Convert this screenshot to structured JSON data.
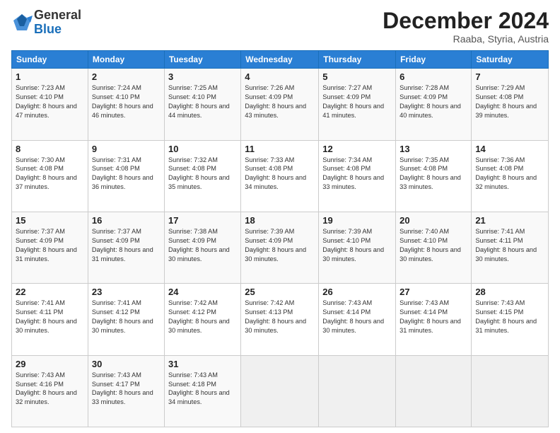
{
  "logo": {
    "general": "General",
    "blue": "Blue"
  },
  "title": "December 2024",
  "location": "Raaba, Styria, Austria",
  "days_of_week": [
    "Sunday",
    "Monday",
    "Tuesday",
    "Wednesday",
    "Thursday",
    "Friday",
    "Saturday"
  ],
  "weeks": [
    [
      {
        "day": "1",
        "sunrise": "7:23 AM",
        "sunset": "4:10 PM",
        "daylight": "8 hours and 47 minutes."
      },
      {
        "day": "2",
        "sunrise": "7:24 AM",
        "sunset": "4:10 PM",
        "daylight": "8 hours and 46 minutes."
      },
      {
        "day": "3",
        "sunrise": "7:25 AM",
        "sunset": "4:10 PM",
        "daylight": "8 hours and 44 minutes."
      },
      {
        "day": "4",
        "sunrise": "7:26 AM",
        "sunset": "4:09 PM",
        "daylight": "8 hours and 43 minutes."
      },
      {
        "day": "5",
        "sunrise": "7:27 AM",
        "sunset": "4:09 PM",
        "daylight": "8 hours and 41 minutes."
      },
      {
        "day": "6",
        "sunrise": "7:28 AM",
        "sunset": "4:09 PM",
        "daylight": "8 hours and 40 minutes."
      },
      {
        "day": "7",
        "sunrise": "7:29 AM",
        "sunset": "4:08 PM",
        "daylight": "8 hours and 39 minutes."
      }
    ],
    [
      {
        "day": "8",
        "sunrise": "7:30 AM",
        "sunset": "4:08 PM",
        "daylight": "8 hours and 37 minutes."
      },
      {
        "day": "9",
        "sunrise": "7:31 AM",
        "sunset": "4:08 PM",
        "daylight": "8 hours and 36 minutes."
      },
      {
        "day": "10",
        "sunrise": "7:32 AM",
        "sunset": "4:08 PM",
        "daylight": "8 hours and 35 minutes."
      },
      {
        "day": "11",
        "sunrise": "7:33 AM",
        "sunset": "4:08 PM",
        "daylight": "8 hours and 34 minutes."
      },
      {
        "day": "12",
        "sunrise": "7:34 AM",
        "sunset": "4:08 PM",
        "daylight": "8 hours and 33 minutes."
      },
      {
        "day": "13",
        "sunrise": "7:35 AM",
        "sunset": "4:08 PM",
        "daylight": "8 hours and 33 minutes."
      },
      {
        "day": "14",
        "sunrise": "7:36 AM",
        "sunset": "4:08 PM",
        "daylight": "8 hours and 32 minutes."
      }
    ],
    [
      {
        "day": "15",
        "sunrise": "7:37 AM",
        "sunset": "4:09 PM",
        "daylight": "8 hours and 31 minutes."
      },
      {
        "day": "16",
        "sunrise": "7:37 AM",
        "sunset": "4:09 PM",
        "daylight": "8 hours and 31 minutes."
      },
      {
        "day": "17",
        "sunrise": "7:38 AM",
        "sunset": "4:09 PM",
        "daylight": "8 hours and 30 minutes."
      },
      {
        "day": "18",
        "sunrise": "7:39 AM",
        "sunset": "4:09 PM",
        "daylight": "8 hours and 30 minutes."
      },
      {
        "day": "19",
        "sunrise": "7:39 AM",
        "sunset": "4:10 PM",
        "daylight": "8 hours and 30 minutes."
      },
      {
        "day": "20",
        "sunrise": "7:40 AM",
        "sunset": "4:10 PM",
        "daylight": "8 hours and 30 minutes."
      },
      {
        "day": "21",
        "sunrise": "7:41 AM",
        "sunset": "4:11 PM",
        "daylight": "8 hours and 30 minutes."
      }
    ],
    [
      {
        "day": "22",
        "sunrise": "7:41 AM",
        "sunset": "4:11 PM",
        "daylight": "8 hours and 30 minutes."
      },
      {
        "day": "23",
        "sunrise": "7:41 AM",
        "sunset": "4:12 PM",
        "daylight": "8 hours and 30 minutes."
      },
      {
        "day": "24",
        "sunrise": "7:42 AM",
        "sunset": "4:12 PM",
        "daylight": "8 hours and 30 minutes."
      },
      {
        "day": "25",
        "sunrise": "7:42 AM",
        "sunset": "4:13 PM",
        "daylight": "8 hours and 30 minutes."
      },
      {
        "day": "26",
        "sunrise": "7:43 AM",
        "sunset": "4:14 PM",
        "daylight": "8 hours and 30 minutes."
      },
      {
        "day": "27",
        "sunrise": "7:43 AM",
        "sunset": "4:14 PM",
        "daylight": "8 hours and 31 minutes."
      },
      {
        "day": "28",
        "sunrise": "7:43 AM",
        "sunset": "4:15 PM",
        "daylight": "8 hours and 31 minutes."
      }
    ],
    [
      {
        "day": "29",
        "sunrise": "7:43 AM",
        "sunset": "4:16 PM",
        "daylight": "8 hours and 32 minutes."
      },
      {
        "day": "30",
        "sunrise": "7:43 AM",
        "sunset": "4:17 PM",
        "daylight": "8 hours and 33 minutes."
      },
      {
        "day": "31",
        "sunrise": "7:43 AM",
        "sunset": "4:18 PM",
        "daylight": "8 hours and 34 minutes."
      },
      null,
      null,
      null,
      null
    ]
  ]
}
